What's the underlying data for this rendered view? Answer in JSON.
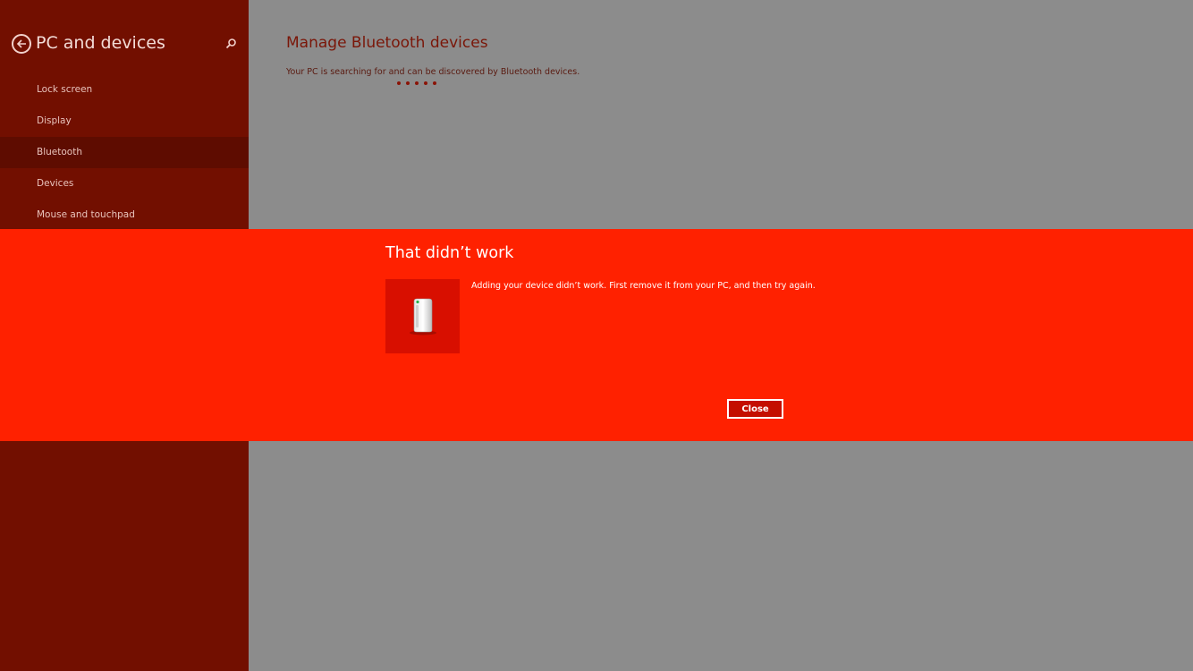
{
  "sidebar": {
    "title": "PC and devices",
    "back_icon": "back-arrow-icon",
    "search_icon": "search-icon",
    "items": [
      {
        "label": "Lock screen",
        "active": false
      },
      {
        "label": "Display",
        "active": false
      },
      {
        "label": "Bluetooth",
        "active": true
      },
      {
        "label": "Devices",
        "active": false
      },
      {
        "label": "Mouse and touchpad",
        "active": false
      }
    ]
  },
  "main": {
    "title": "Manage Bluetooth devices",
    "status": "Your PC is searching for and can be discovered by Bluetooth devices."
  },
  "dialog": {
    "title": "That didn’t work",
    "message": "Adding your device didn’t work. First remove it from your PC, and then try again.",
    "device_icon": "device-icon",
    "close_label": "Close"
  },
  "colors": {
    "sidebar_bg": "#720f00",
    "sidebar_active": "#5e0c00",
    "content_bg": "#8c8c8c",
    "dialog_bg": "#ff2100",
    "device_tile_bg": "#d80f00",
    "close_button_bg": "#c40e00"
  }
}
